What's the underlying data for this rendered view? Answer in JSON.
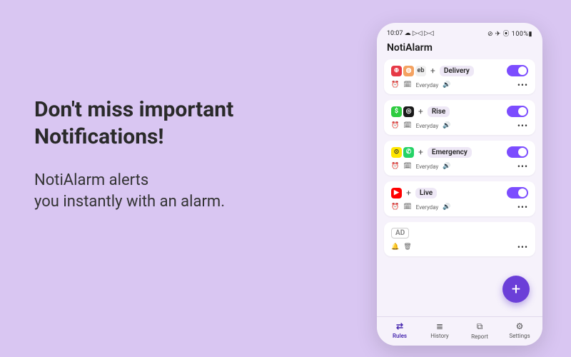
{
  "hero": {
    "headline_l1": "Don't miss important",
    "headline_l2": "Notifications!",
    "sub_l1": "NotiAlarm alerts",
    "sub_l2": "you instantly with an alarm."
  },
  "status": {
    "time": "10:07",
    "left_icons": "☁ ▷◁ ▷◁",
    "right": "⊘ ✈ ⦿ 100%▮"
  },
  "app": {
    "title": "NotiAlarm",
    "schedule_label": "Everyday",
    "fab": "+",
    "ad_label": "AD"
  },
  "rules": [
    {
      "name": "Delivery",
      "icons": [
        {
          "bg": "#e63946",
          "glyph": "⊕"
        },
        {
          "bg": "#f4a261",
          "glyph": "◍"
        },
        {
          "bg": "#f0f0f0",
          "glyph": "eb",
          "fg": "#444"
        }
      ]
    },
    {
      "name": "Rise",
      "icons": [
        {
          "bg": "#2ecc40",
          "glyph": "$"
        },
        {
          "bg": "#1a1a1a",
          "glyph": "◎"
        }
      ]
    },
    {
      "name": "Emergency",
      "icons": [
        {
          "bg": "#ffe600",
          "glyph": "⊙",
          "fg": "#333"
        },
        {
          "bg": "#25d366",
          "glyph": "✆"
        }
      ]
    },
    {
      "name": "Live",
      "icons": [
        {
          "bg": "#ff0000",
          "glyph": "▶"
        }
      ]
    }
  ],
  "nav": [
    {
      "icon": "⇄",
      "label": "Rules",
      "active": true
    },
    {
      "icon": "≣",
      "label": "History",
      "active": false
    },
    {
      "icon": "⧉",
      "label": "Report",
      "active": false
    },
    {
      "icon": "⚙",
      "label": "Settings",
      "active": false
    }
  ]
}
